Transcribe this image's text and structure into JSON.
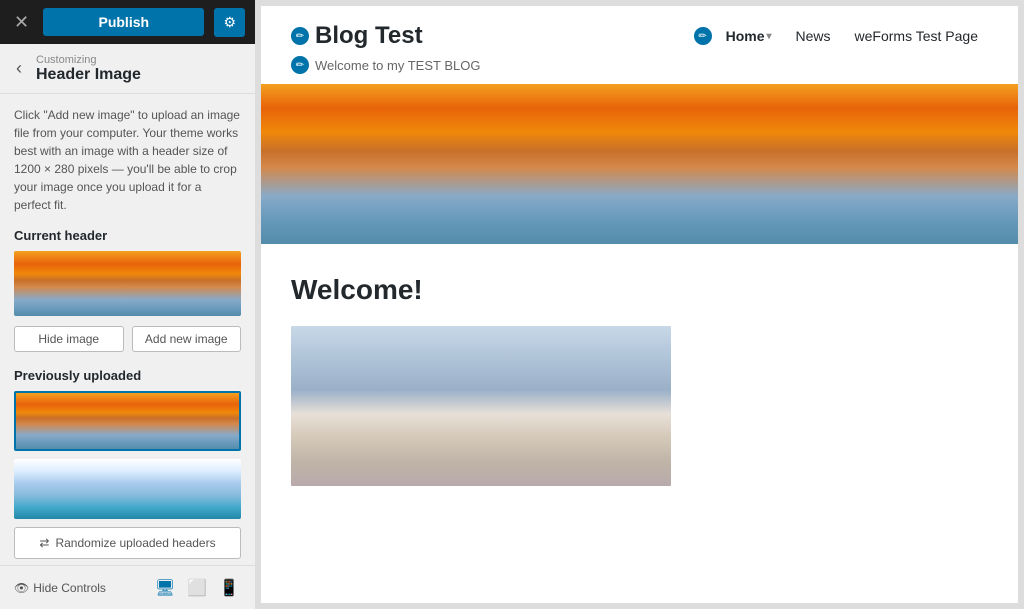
{
  "topbar": {
    "close_label": "✕",
    "publish_label": "Publish",
    "settings_label": "⚙"
  },
  "navbar": {
    "back_label": "‹",
    "customizing_label": "Customizing",
    "header_image_label": "Header Image"
  },
  "panel": {
    "description": "Click \"Add new image\" to upload an image file from your computer. Your theme works best with an image with a header size of 1200 × 280 pixels — you'll be able to crop your image once you upload it for a perfect fit.",
    "current_header_label": "Current header",
    "hide_image_label": "Hide image",
    "add_new_image_label": "Add new image",
    "previously_uploaded_label": "Previously uploaded",
    "randomize_label": "Randomize uploaded headers"
  },
  "bottombar": {
    "hide_controls_label": "Hide Controls"
  },
  "preview": {
    "site_title": "Blog Test",
    "site_tagline": "Welcome to my TEST BLOG",
    "nav_home": "Home",
    "nav_news": "News",
    "nav_weForms": "weForms Test Page",
    "welcome_heading": "Welcome!"
  }
}
